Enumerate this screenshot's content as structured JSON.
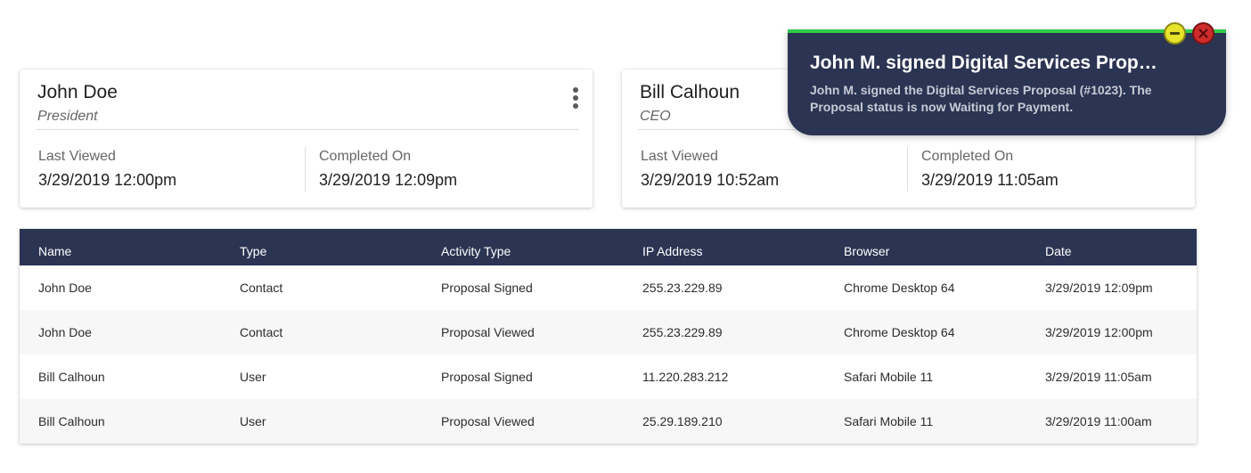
{
  "signers": [
    {
      "name": "John Doe",
      "role": "President",
      "last_viewed_label": "Last Viewed",
      "last_viewed": "3/29/2019  12:00pm",
      "completed_label": "Completed On",
      "completed_on": "3/29/2019  12:09pm"
    },
    {
      "name": "Bill Calhoun",
      "role": "CEO",
      "last_viewed_label": "Last Viewed",
      "last_viewed": "3/29/2019  10:52am",
      "completed_label": "Completed On",
      "completed_on": "3/29/2019  11:05am"
    }
  ],
  "activity_table": {
    "headers": [
      "Name",
      "Type",
      "Activity Type",
      "IP Address",
      "Browser",
      "Date"
    ],
    "rows": [
      [
        "John Doe",
        "Contact",
        "Proposal Signed",
        "255.23.229.89",
        "Chrome Desktop 64",
        "3/29/2019  12:09pm"
      ],
      [
        "John Doe",
        "Contact",
        "Proposal Viewed",
        "255.23.229.89",
        "Chrome Desktop 64",
        "3/29/2019  12:00pm"
      ],
      [
        "Bill Calhoun",
        "User",
        "Proposal Signed",
        "11.220.283.212",
        "Safari Mobile 11",
        "3/29/2019  11:05am"
      ],
      [
        "Bill Calhoun",
        "User",
        "Proposal Viewed",
        "25.29.189.210",
        "Safari Mobile 11",
        "3/29/2019  11:00am"
      ]
    ]
  },
  "notification": {
    "title": "John M. signed Digital Services Prop…",
    "body": "John M. signed the Digital Services Proposal (#1023). The Proposal status is now Waiting for Payment.",
    "minimize_icon": "minus-icon",
    "close_icon": "x-icon"
  },
  "colors": {
    "header_bg": "#2b3452",
    "toast_bg": "#2b3452",
    "toast_accent": "#2ecc4a",
    "minimize_button": "#e6e32a",
    "close_button": "#d02c2c"
  }
}
